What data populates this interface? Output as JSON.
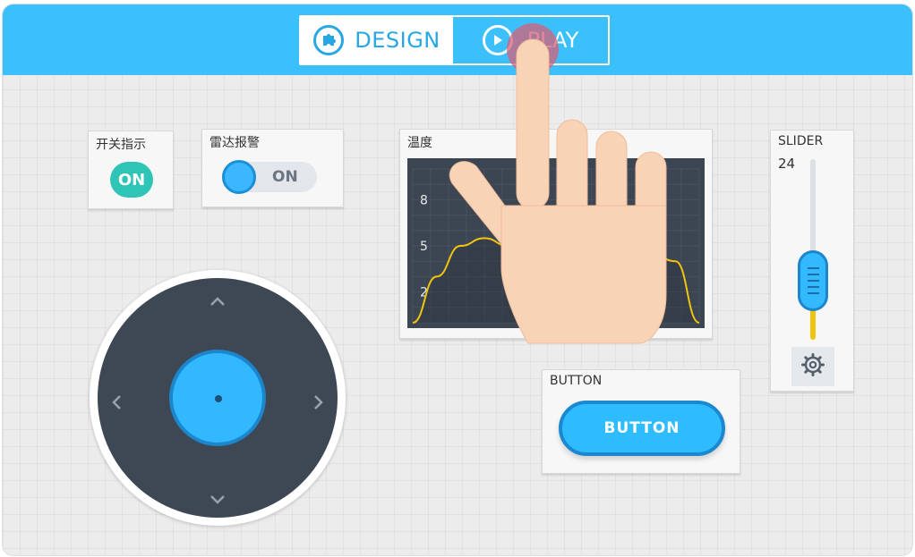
{
  "modes": {
    "design_label": "DESIGN",
    "play_label": "PLAY"
  },
  "switch_widget": {
    "label": "开关指示",
    "value": "ON"
  },
  "toggle_widget": {
    "label": "雷达报警",
    "value": "ON"
  },
  "joystick": {
    "up_icon": "chevron-up-icon",
    "down_icon": "chevron-down-icon",
    "left_icon": "chevron-left-icon",
    "right_icon": "chevron-right-icon"
  },
  "button_widget": {
    "label": "BUTTON",
    "button_text": "BUTTON"
  },
  "slider_widget": {
    "label": "SLIDER",
    "value": "24",
    "level_fraction": 0.24
  },
  "chart_data": {
    "type": "line",
    "title": "温度",
    "yticks": [
      8,
      5,
      2
    ],
    "ylim": [
      0,
      10
    ],
    "series": [
      {
        "color": "#f1c40f",
        "x": [
          0,
          1,
          2,
          3,
          4,
          5,
          6,
          7,
          8,
          9,
          10,
          11,
          12
        ],
        "values": [
          0,
          3,
          5,
          5.5,
          5,
          3.5,
          2,
          2,
          2.5,
          3.5,
          4.5,
          4,
          0
        ]
      }
    ]
  },
  "colors": {
    "topbar": "#3bc0fb",
    "accent": "#2ebcff",
    "led_on": "#2ec4b6",
    "chart_bg": "#3c4652",
    "chart_line": "#f1c40f"
  }
}
